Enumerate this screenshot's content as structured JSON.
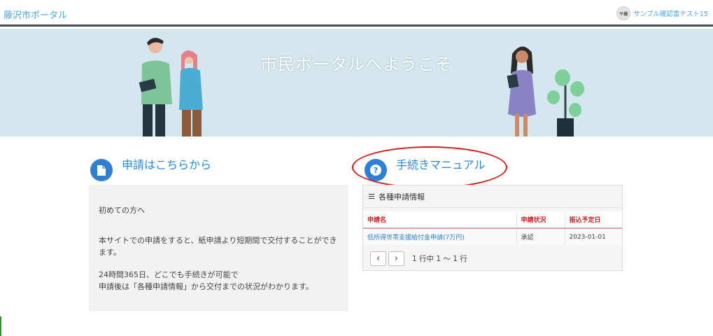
{
  "header": {
    "brand": "藤沢市ポータル",
    "user_initials": "サ様",
    "user_name": "サンプル確認書テスト15"
  },
  "hero": {
    "title": "市民ポータルへようこそ"
  },
  "apply_section": {
    "title": "申請はこちらから",
    "icon": "document-icon",
    "lines": [
      "初めての方へ",
      "本サイトでの申請をすると、紙申請より短期間で交付することができます。",
      "24時間365日、どこでも手続きが可能で",
      "申請後は「各種申請情報」から交付までの状況がわかります。"
    ]
  },
  "manual_section": {
    "title": "手続きマニュアル",
    "icon": "question-icon"
  },
  "applications_card": {
    "title": "各種申請情報",
    "columns": [
      "申請名",
      "申請状況",
      "振込予定日"
    ],
    "rows": [
      [
        "低所得世帯支援給付金申請(7万円)",
        "承認",
        "2023-01-01"
      ]
    ],
    "pagination_info": "1 行中 1 ～ 1 行",
    "prev_label": "‹",
    "next_label": "›"
  },
  "colors": {
    "accent": "#2b8ad8",
    "header_border": "#444c55",
    "hero_bg": "#d5e7ee",
    "table_header_text": "#d11f1f",
    "highlight_oval": "#d21a1a"
  }
}
